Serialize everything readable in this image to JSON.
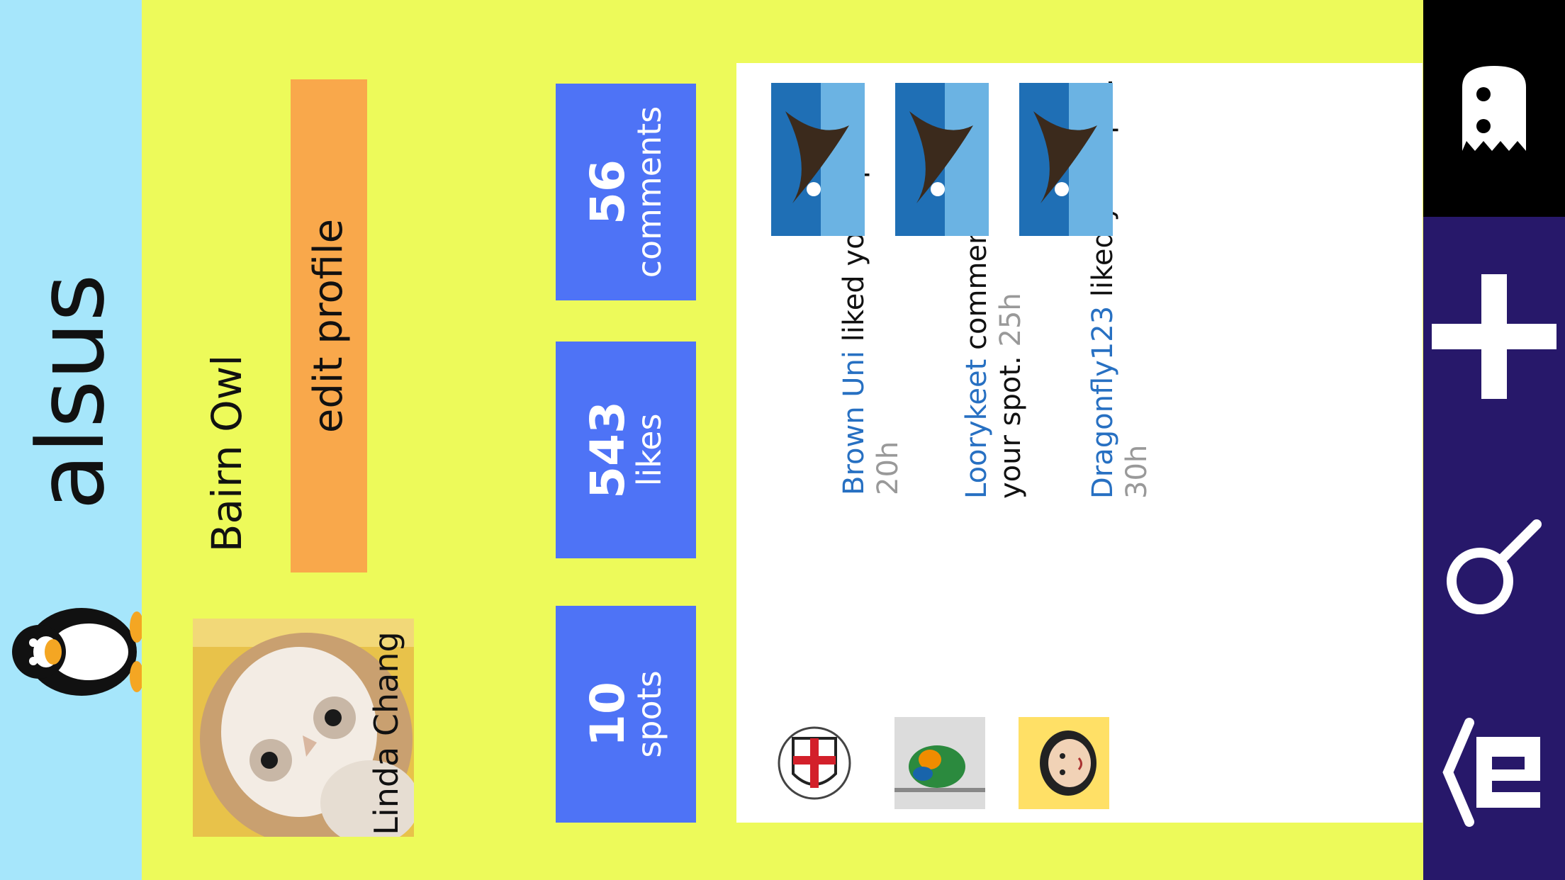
{
  "app": {
    "name": "alsus",
    "logo_icon": "penguin-icon"
  },
  "profile": {
    "name": "Linda Chang",
    "username": "Bairn Owl",
    "photo_icon": "barn-owl-photo",
    "edit_label": "edit profile"
  },
  "stats": [
    {
      "value": "10",
      "label": "spots"
    },
    {
      "value": "543",
      "label": "likes"
    },
    {
      "value": "56",
      "label": "comments"
    }
  ],
  "notifications": [
    {
      "user": "Brown Uni",
      "action": " liked your spot. ",
      "time": "20h",
      "avatar_icon": "crest-avatar",
      "thumbnail_icon": "eagle-photo"
    },
    {
      "user": "Loorykeet",
      "action": " commented on your spot. ",
      "time": "25h",
      "avatar_icon": "lorikeet-avatar",
      "thumbnail_icon": "eagle-photo"
    },
    {
      "user": "Dragonfly123",
      "action": " liked your spot. ",
      "time": "30h",
      "avatar_icon": "person-avatar",
      "thumbnail_icon": "eagle-photo"
    }
  ],
  "nav": [
    {
      "name": "profile",
      "icon": "ghost-icon",
      "active": true
    },
    {
      "name": "add",
      "icon": "plus-icon",
      "active": false
    },
    {
      "name": "search",
      "icon": "search-icon",
      "active": false
    },
    {
      "name": "home",
      "icon": "home-icon",
      "active": false
    }
  ],
  "colors": {
    "topbar": "#a6e6fb",
    "content": "#edfa5a",
    "nav": "#27186a",
    "nav_active": "#000000",
    "edit_button": "#f9a84b",
    "stat_box": "#4e73f6",
    "link": "#2770c2",
    "time": "#999999"
  }
}
